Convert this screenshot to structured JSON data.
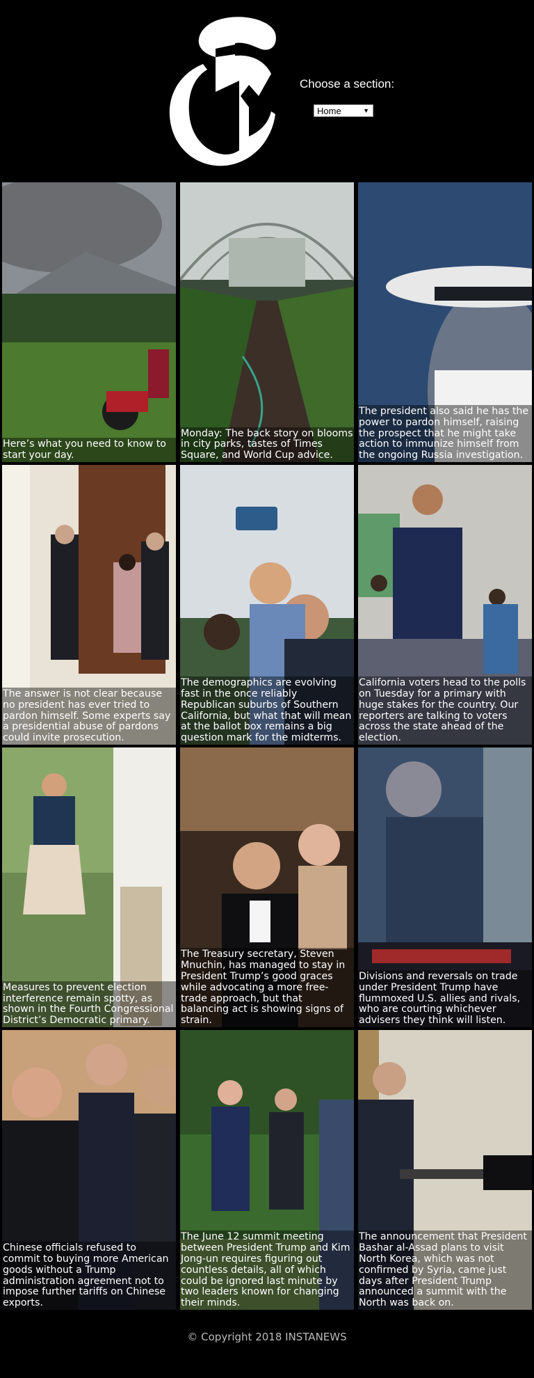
{
  "header": {
    "logo_glyph": "T",
    "section_prompt": "Choose a section:",
    "section_select": {
      "selected": "Home"
    }
  },
  "articles": [
    {
      "caption": "Here’s what you need to know to start your day.",
      "image": "volcano-motorbike-photo"
    },
    {
      "caption": "Monday: The back story on blooms in city parks, tastes of Times Square, and World Cup advice.",
      "image": "greenhouse-photo"
    },
    {
      "caption": "The president also said he has the power to pardon himself, raising the prospect that he might take action to immunize himself from the ongoing Russia investigation.",
      "image": "officer-cap-photo"
    },
    {
      "caption": "The answer is not clear because no president has ever tried to pardon himself. Some experts say a presidential abuse of pardons could invite prosecution.",
      "image": "people-by-door-photo"
    },
    {
      "caption": "The demographics are evolving fast in the once reliably Republican suburbs of Southern California, but what that will mean at the ballot box remains a big question mark for the midterms.",
      "image": "selfie-group-photo"
    },
    {
      "caption": "California voters head to the polls on Tuesday for a primary with huge stakes for the country. Our reporters are talking to voters across the state ahead of the election.",
      "image": "candidate-classroom-photo"
    },
    {
      "caption": "Measures to prevent election interference remain spotty, as shown in the Fourth Congressional District’s Democratic primary.",
      "image": "woman-waving-photo"
    },
    {
      "caption": "The Treasury secretary, Steven Mnuchin, has managed to stay in President Trump’s good graces while advocating a more free-trade approach, but that balancing act is showing signs of strain.",
      "image": "tuxedo-event-photo"
    },
    {
      "caption": "Divisions and reversals on trade under President Trump have flummoxed U.S. allies and rivals, who are courting whichever advisers they think will listen.",
      "image": "reflection-city-photo"
    },
    {
      "caption": "Chinese officials refused to commit to buying more American goods without a Trump administration agreement not to impose further tariffs on Chinese exports.",
      "image": "officials-meeting-photo"
    },
    {
      "caption": "The June 12 summit meeting between President Trump and Kim Jong-un requires figuring out countless details, all of which could be ignored last minute by two leaders known for changing their minds.",
      "image": "leaders-walking-photo"
    },
    {
      "caption": "The announcement that President Bashar al-Assad plans to visit North Korea, which was not confirmed by Syria, came just days after President Trump announced a summit with the North was back on.",
      "image": "credentials-handover-photo"
    }
  ],
  "footer": {
    "copyright": "© Copyright 2018 INSTANEWS"
  }
}
